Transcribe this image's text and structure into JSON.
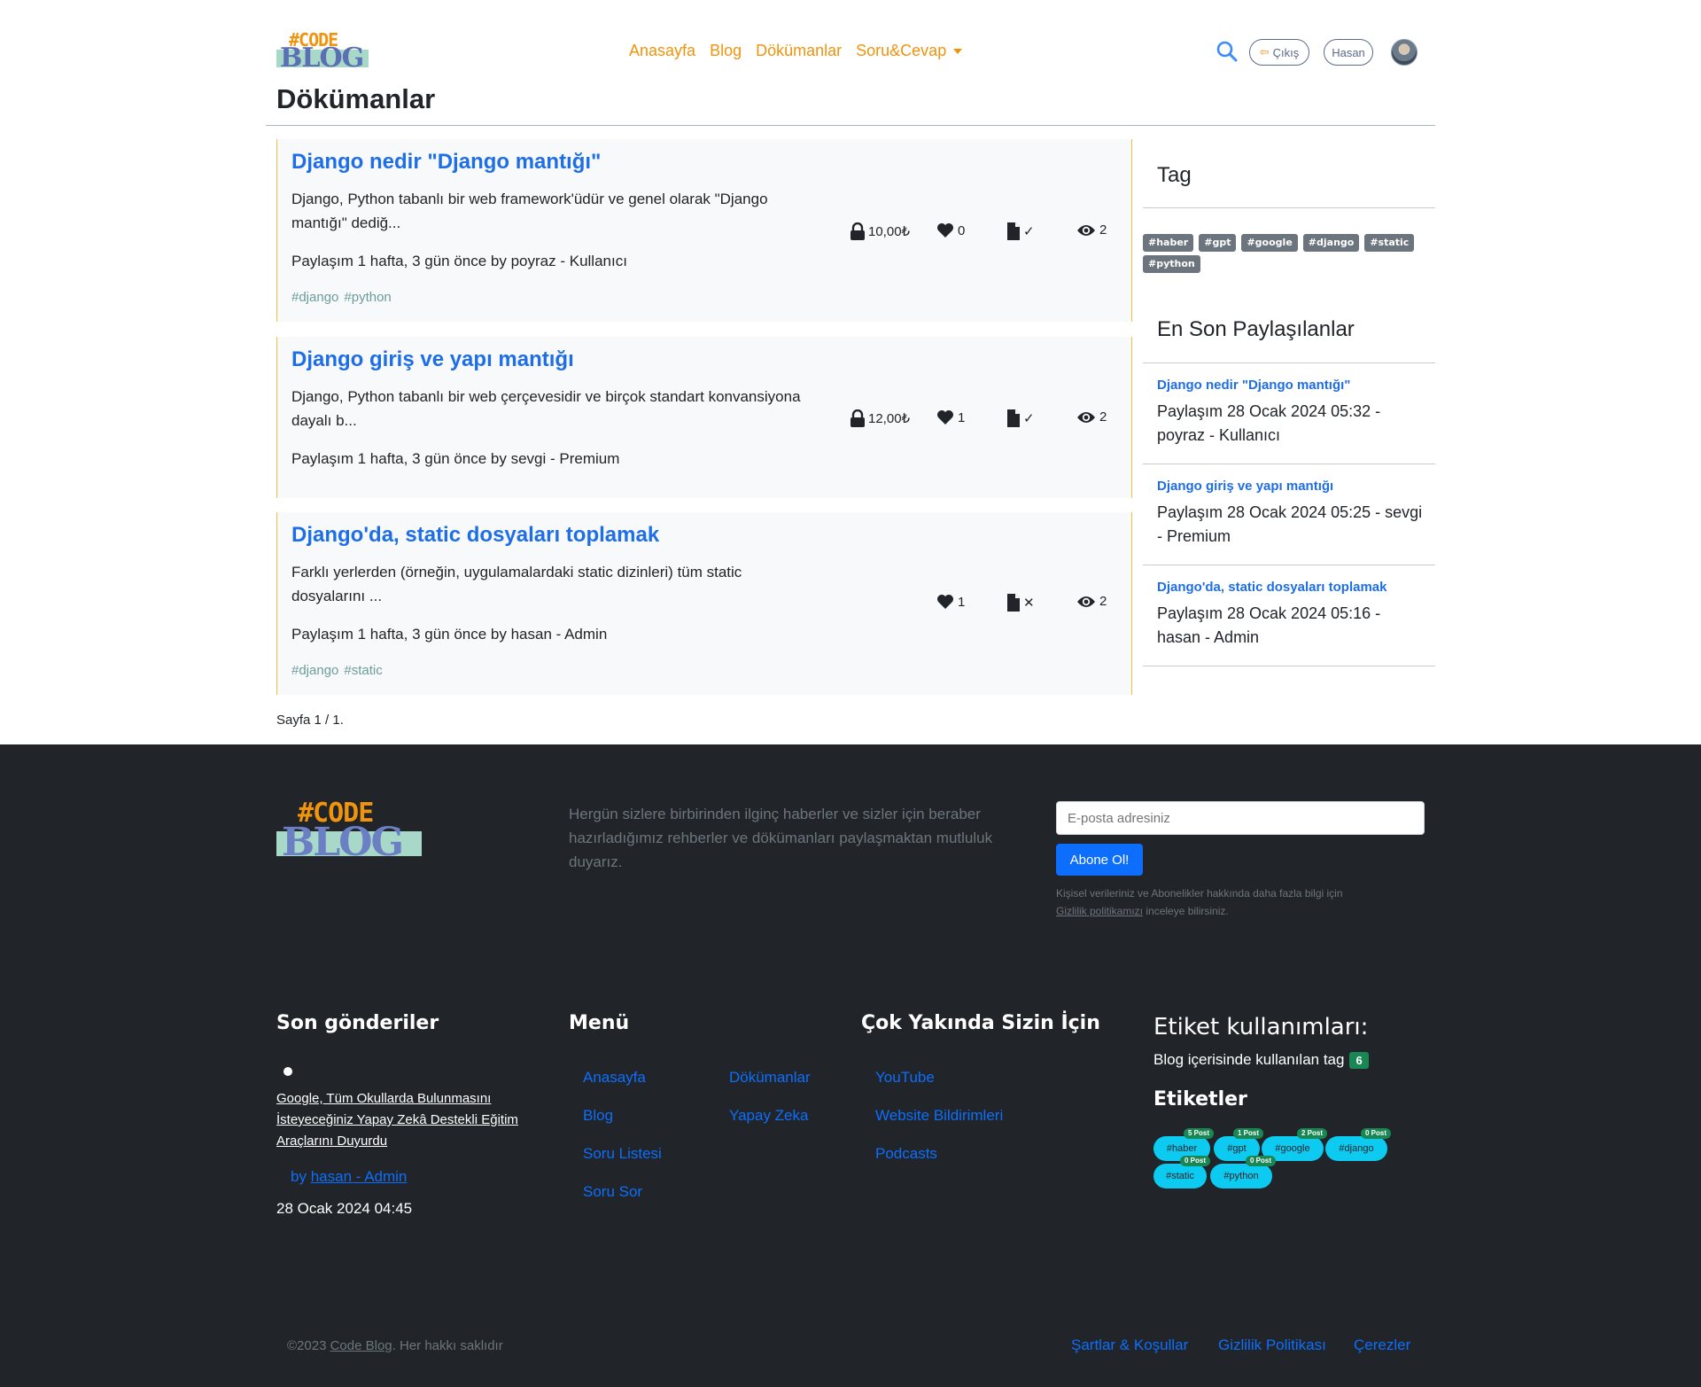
{
  "header": {
    "logo": {
      "code": "#CODE",
      "blog": "BLOG"
    },
    "nav": [
      "Anasayfa",
      "Blog",
      "Dökümanlar",
      "Soru&Cevap"
    ],
    "logout_label": "Çıkış",
    "user_label": "Hasan"
  },
  "page_title": "Dökümanlar",
  "posts": [
    {
      "title": "Django nedir \"Django mantığı\"",
      "excerpt": "Django, Python tabanlı bir web framework'üdür ve genel olarak \"Django mantığı\" dediğ...",
      "meta": "Paylaşım 1 hafta, 3 gün önce by poyraz - Kullanıcı",
      "tags": [
        "#django",
        "#python"
      ],
      "price": "10,00₺",
      "likes": "0",
      "views": "2",
      "doc_status": "✓"
    },
    {
      "title": "Django giriş ve yapı mantığı",
      "excerpt": "Django, Python tabanlı bir web çerçevesidir ve birçok standart konvansiyona dayalı b...",
      "meta": "Paylaşım 1 hafta, 3 gün önce by sevgi - Premium",
      "tags": [],
      "price": "12,00₺",
      "likes": "1",
      "views": "2",
      "doc_status": "✓"
    },
    {
      "title": "Django'da, static dosyaları toplamak",
      "excerpt": "Farklı yerlerden (örneğin, uygulamalardaki static dizinleri) tüm static dosyalarını ...",
      "meta": "Paylaşım 1 hafta, 3 gün önce by hasan - Admin",
      "tags": [
        "#django",
        "#static"
      ],
      "price": "",
      "likes": "1",
      "views": "2",
      "doc_status": "✕"
    }
  ],
  "sidebar": {
    "tag_heading": "Tag",
    "tags": [
      "#haber",
      "#gpt",
      "#google",
      "#django",
      "#static",
      "#python"
    ],
    "recent_heading": "En Son Paylaşılanlar",
    "recent": [
      {
        "title": "Django nedir \"Django mantığı\"",
        "meta": "Paylaşım 28 Ocak 2024 05:32 - poyraz - Kullanıcı"
      },
      {
        "title": "Django giriş ve yapı mantığı",
        "meta": "Paylaşım 28 Ocak 2024 05:25 - sevgi - Premium"
      },
      {
        "title": "Django'da, static dosyaları toplamak",
        "meta": "Paylaşım 28 Ocak 2024 05:16 - hasan - Admin"
      }
    ]
  },
  "pager": "Sayfa 1 / 1.",
  "footer": {
    "logo": {
      "code": "#CODE",
      "blog": "BLOG"
    },
    "description": "Hergün sizlere birbirinden ilginç haberler ve sizler için beraber hazırladığımız rehberler ve dökümanları paylaşmaktan mutluluk duyarız.",
    "email_placeholder": "E-posta adresiniz",
    "subscribe_label": "Abone Ol!",
    "privacy_text": "Kişisel verileriniz ve Abonelikler hakkında daha fazla bilgi için",
    "privacy_link": "Gizlilik politikamızı",
    "privacy_suffix": "inceleye bilirsiniz.",
    "recent_heading": "Son gönderiler",
    "recent_post": {
      "title": "Google, Tüm Okullarda Bulunmasını İsteyeceğiniz Yapay Zekâ Destekli Eğitim Araçlarını Duyurdu",
      "by": "by",
      "author": "hasan - Admin",
      "date": "28 Ocak 2024 04:45"
    },
    "menu_heading": "Menü",
    "menu": [
      "Anasayfa",
      "Blog",
      "Soru Listesi",
      "Soru Sor",
      "Dökümanlar",
      "Yapay Zeka"
    ],
    "soon_heading": "Çok Yakında Sizin İçin",
    "soon": [
      "YouTube",
      "Website Bildirimleri",
      "Podcasts"
    ],
    "tags_usage_heading": "Etiket kullanımları:",
    "tags_usage_text": "Blog içerisinde kullanılan tag",
    "tags_usage_count": "6",
    "tags_heading": "Etiketler",
    "tags": [
      {
        "name": "#haber",
        "count": "5 Post"
      },
      {
        "name": "#gpt",
        "count": "1 Post"
      },
      {
        "name": "#google",
        "count": "2 Post"
      },
      {
        "name": "#django",
        "count": "0 Post"
      },
      {
        "name": "#static",
        "count": "0 Post"
      },
      {
        "name": "#python",
        "count": "0 Post"
      }
    ],
    "copyright_prefix": "©2023",
    "copyright_link": "Code Blog",
    "copyright_suffix": ". Her hakkı saklıdır",
    "bottom_links": [
      "Şartlar & Koşullar",
      "Gizlilik Politikası",
      "Çerezler"
    ]
  },
  "colors": {
    "accent_orange": "#f0930d",
    "link_blue": "#1e6ee8",
    "footer_bg": "#212529",
    "tag_cyan": "#0dcaf0",
    "badge_green": "#198754"
  }
}
